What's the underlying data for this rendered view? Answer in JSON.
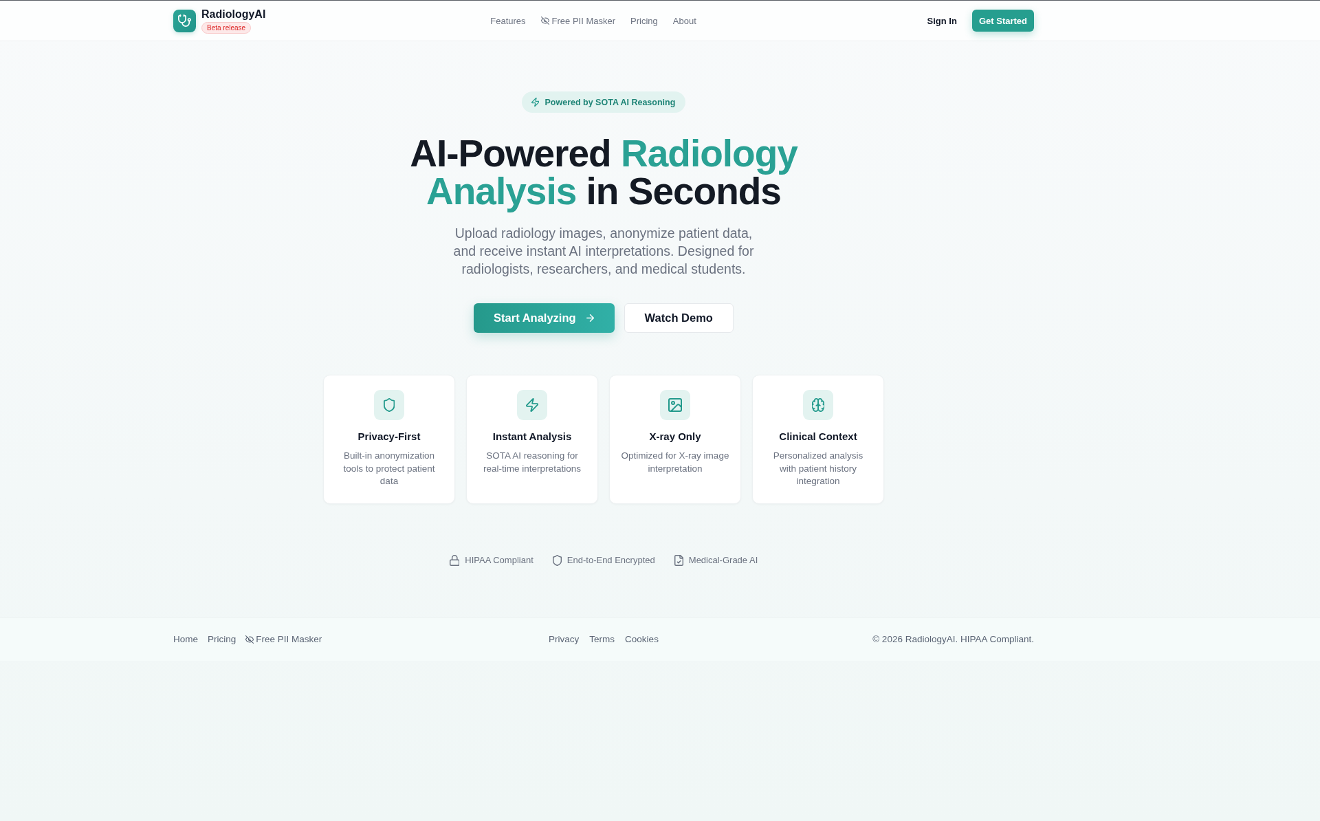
{
  "header": {
    "brand": "RadiologyAI",
    "badge": "Beta release",
    "nav": [
      "Features",
      "Free PII Masker",
      "Pricing",
      "About"
    ],
    "actions": [
      {
        "label": "Sign In",
        "kind": "link"
      },
      {
        "label": "Get Started",
        "kind": "primary"
      }
    ]
  },
  "hero": {
    "badge": "Powered by SOTA AI Reasoning",
    "title": [
      {
        "text": "AI-Powered",
        "accent": false
      },
      {
        "text": "Radiology Analysis",
        "accent": true
      },
      {
        "text": "in Seconds",
        "accent": false
      }
    ],
    "description": "Upload radiology images, anonymize patient data, and receive instant AI interpretations. Designed for radiologists, researchers, and medical students.",
    "actions": [
      {
        "label": "Start Analyzing",
        "kind": "primary"
      },
      {
        "label": "Watch Demo",
        "kind": "secondary"
      }
    ]
  },
  "features": [
    {
      "title": "Privacy-First",
      "description": "Built-in anonymization tools to protect patient data"
    },
    {
      "title": "Instant Analysis",
      "description": "SOTA AI reasoning for real-time interpretations"
    },
    {
      "title": "X-ray Only",
      "description": "Optimized for X-ray image interpretation"
    },
    {
      "title": "Clinical Context",
      "description": "Personalized analysis with patient history integration"
    }
  ],
  "trust_badges": [
    "HIPAA Compliant",
    "End-to-End Encrypted",
    "Medical-Grade AI"
  ],
  "footer": {
    "links": [
      "Home",
      "Pricing",
      "Free PII Masker"
    ],
    "legal": [
      "Privacy",
      "Terms",
      "Cookies"
    ],
    "copyright": "© 2026 RadiologyAI. HIPAA Compliant."
  }
}
